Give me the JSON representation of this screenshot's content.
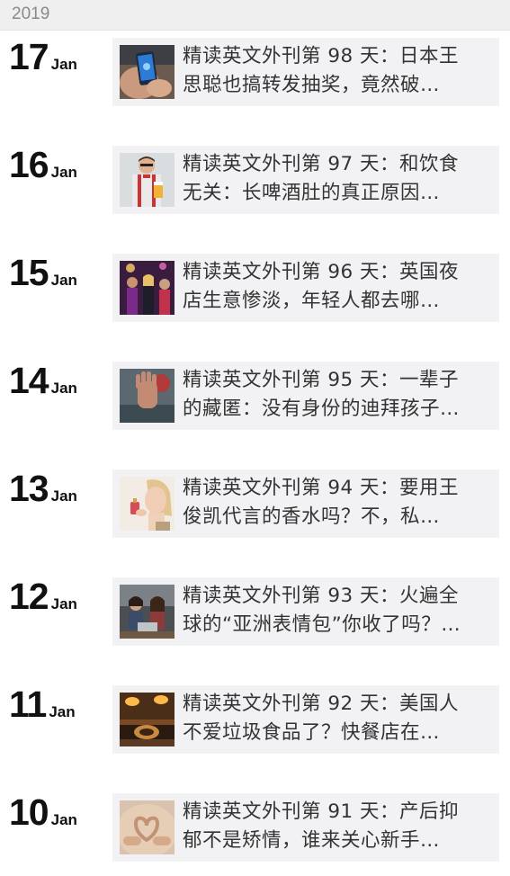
{
  "year": "2019",
  "entries": [
    {
      "day": "17",
      "month": "Jan",
      "title_line1": "精读英文外刊第 98 天：日本王",
      "title_line2": "思聪也搞转发抽奖，竟然破…",
      "thumb": "phone-in-hand"
    },
    {
      "day": "16",
      "month": "Jan",
      "title_line1": "精读英文外刊第 97 天：和饮食",
      "title_line2": "无关：长啤酒肚的真正原因…",
      "thumb": "man-with-beer"
    },
    {
      "day": "15",
      "month": "Jan",
      "title_line1": "精读英文外刊第 96 天：英国夜",
      "title_line2": "店生意惨淡，年轻人都去哪…",
      "thumb": "nightclub-party"
    },
    {
      "day": "14",
      "month": "Jan",
      "title_line1": "精读英文外刊第 95 天：一辈子",
      "title_line2": "的藏匿：没有身份的迪拜孩子…",
      "thumb": "hand-stop"
    },
    {
      "day": "13",
      "month": "Jan",
      "title_line1": "精读英文外刊第 94 天：要用王",
      "title_line2": "俊凯代言的香水吗？不，私…",
      "thumb": "woman-perfume"
    },
    {
      "day": "12",
      "month": "Jan",
      "title_line1": "精读英文外刊第 93 天：火遍全",
      "title_line2": "球的“亚洲表情包”你收了吗？…",
      "thumb": "people-laptop"
    },
    {
      "day": "11",
      "month": "Jan",
      "title_line1": "精读英文外刊第 92 天：美国人",
      "title_line2": "不爱垃圾食品了？快餐店在…",
      "thumb": "restaurant-lamps"
    },
    {
      "day": "10",
      "month": "Jan",
      "title_line1": "精读英文外刊第 91 天：产后抑",
      "title_line2": "郁不是矫情，谁来关心新手…",
      "thumb": "heart-hands-belly"
    }
  ]
}
